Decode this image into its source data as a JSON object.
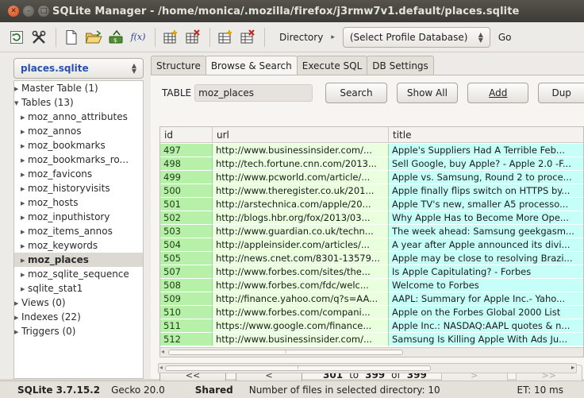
{
  "window": {
    "title": "SQLite Manager - /home/monica/.mozilla/firefox/j3rmw7v1.default/places.sqlite"
  },
  "toolbar": {
    "directory_label": "Directory",
    "profile_select": "(Select Profile Database)",
    "go_label": "Go",
    "function_label": "f(x)"
  },
  "left": {
    "db_select": "places.sqlite",
    "tree": [
      {
        "label": "Master Table (1)",
        "level": 1,
        "expanded": false
      },
      {
        "label": "Tables (13)",
        "level": 1,
        "expanded": true
      },
      {
        "label": "moz_anno_attributes",
        "level": 2
      },
      {
        "label": "moz_annos",
        "level": 2
      },
      {
        "label": "moz_bookmarks",
        "level": 2
      },
      {
        "label": "moz_bookmarks_ro...",
        "level": 2
      },
      {
        "label": "moz_favicons",
        "level": 2
      },
      {
        "label": "moz_historyvisits",
        "level": 2
      },
      {
        "label": "moz_hosts",
        "level": 2
      },
      {
        "label": "moz_inputhistory",
        "level": 2
      },
      {
        "label": "moz_items_annos",
        "level": 2
      },
      {
        "label": "moz_keywords",
        "level": 2
      },
      {
        "label": "moz_places",
        "level": 2,
        "selected": true
      },
      {
        "label": "moz_sqlite_sequence",
        "level": 2
      },
      {
        "label": "sqlite_stat1",
        "level": 2
      },
      {
        "label": "Views (0)",
        "level": 1,
        "expanded": false
      },
      {
        "label": "Indexes (22)",
        "level": 1,
        "expanded": false
      },
      {
        "label": "Triggers (0)",
        "level": 1,
        "expanded": false
      }
    ]
  },
  "tabs": [
    "Structure",
    "Browse & Search",
    "Execute SQL",
    "DB Settings"
  ],
  "active_tab": 1,
  "browse": {
    "table_label": "TABLE",
    "table_name": "moz_places",
    "search_label": "Search",
    "show_all_label": "Show All",
    "add_label": "Add",
    "dup_label": "Dup",
    "columns": [
      "id",
      "url",
      "title"
    ],
    "rows": [
      [
        "497",
        "http://www.businessinsider.com/...",
        "Apple's Suppliers Had A Terrible Feb..."
      ],
      [
        "498",
        "http://tech.fortune.cnn.com/2013...",
        "Sell Google, buy Apple? - Apple 2.0 -F..."
      ],
      [
        "499",
        "http://www.pcworld.com/article/...",
        "Apple vs. Samsung, Round 2 to proce..."
      ],
      [
        "500",
        "http://www.theregister.co.uk/201...",
        "Apple finally flips switch on HTTPS by..."
      ],
      [
        "501",
        "http://arstechnica.com/apple/20...",
        "Apple TV's new, smaller A5 processo..."
      ],
      [
        "502",
        "http://blogs.hbr.org/fox/2013/03...",
        "Why Apple Has to Become More Ope..."
      ],
      [
        "503",
        "http://www.guardian.co.uk/techn...",
        "The week ahead: Samsung geekgasm..."
      ],
      [
        "504",
        "http://appleinsider.com/articles/...",
        "A year after Apple announced its divi..."
      ],
      [
        "505",
        "http://news.cnet.com/8301-13579...",
        "Apple may be close to resolving Brazi..."
      ],
      [
        "507",
        "http://www.forbes.com/sites/the...",
        "Is Apple Capitulating? - Forbes"
      ],
      [
        "508",
        "http://www.forbes.com/fdc/welc...",
        "Welcome to Forbes"
      ],
      [
        "509",
        "http://finance.yahoo.com/q?s=AA...",
        "AAPL: Summary for Apple Inc.- Yaho..."
      ],
      [
        "510",
        "http://www.forbes.com/compani...",
        "Apple on the Forbes Global 2000 List"
      ],
      [
        "511",
        "https://www.google.com/finance...",
        "Apple Inc.: NASDAQ:AAPL quotes & n..."
      ],
      [
        "512",
        "http://www.businessinsider.com/...",
        "Samsung Is Killing Apple With Ads Ju..."
      ]
    ]
  },
  "pager": {
    "first": "<<",
    "prev": "<",
    "next": ">",
    "last": ">>",
    "from": "301",
    "to_word": "to",
    "to": "399",
    "of_word": "of",
    "total": "399"
  },
  "status": {
    "version": "SQLite 3.7.15.2",
    "gecko": "Gecko 20.0",
    "mode": "Shared",
    "files": "Number of files in selected directory: 10",
    "elapsed": "ET: 10 ms"
  },
  "colors": {
    "id_bg": "#b7f0a8",
    "url_bg": "#e9ffdd",
    "title_bg": "#c6fff8",
    "selected_db": "#2a4fb0"
  }
}
